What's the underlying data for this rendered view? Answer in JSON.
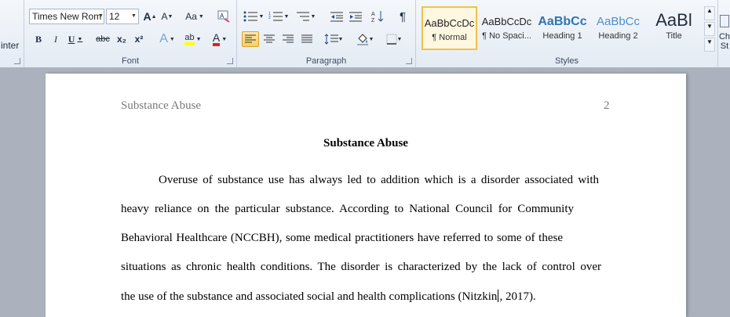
{
  "ribbon": {
    "clipboard": {
      "format_painter_label": "inter"
    },
    "font": {
      "group_label": "Font",
      "font_name": "Times New Rom",
      "font_size": "12",
      "grow_label": "A",
      "shrink_label": "A",
      "change_case_label": "Aa",
      "bold_label": "B",
      "italic_label": "I",
      "underline_label": "U",
      "strikethrough_label": "abc",
      "subscript_label": "x₂",
      "superscript_label": "x²",
      "text_effects_label": "A",
      "highlight_label": "ab",
      "font_color_label": "A"
    },
    "paragraph": {
      "group_label": "Paragraph",
      "pilcrow": "¶"
    },
    "styles": {
      "group_label": "Styles",
      "items": [
        {
          "sample": "AaBbCcDc",
          "name": "¶ Normal"
        },
        {
          "sample": "AaBbCcDc",
          "name": "¶ No Spaci..."
        },
        {
          "sample": "AaBbCc",
          "name": "Heading 1"
        },
        {
          "sample": "AaBbCc",
          "name": "Heading 2"
        },
        {
          "sample": "AaBl",
          "name": "Title"
        }
      ],
      "change_styles_label": "Ch",
      "change_styles_label2": "St"
    }
  },
  "document": {
    "running_head": "Substance Abuse",
    "page_number": "2",
    "title": "Substance Abuse",
    "lines": [
      "Overuse of substance use has always led to addition which is a disorder associated with",
      "heavy reliance on the particular substance. According to National Council for Community",
      "Behavioral Healthcare (NCCBH), some medical practitioners have referred to some of these",
      "situations as chronic health conditions. The disorder is characterized by the lack of control over"
    ],
    "last_line_before_cursor": "the use of the substance and associated social and health complications (Nitzkin",
    "last_line_after_cursor": ", 2017)."
  },
  "colors": {
    "highlight": "#ffff00",
    "font_color": "#e02020",
    "heading_blue": "#2e74b5"
  }
}
